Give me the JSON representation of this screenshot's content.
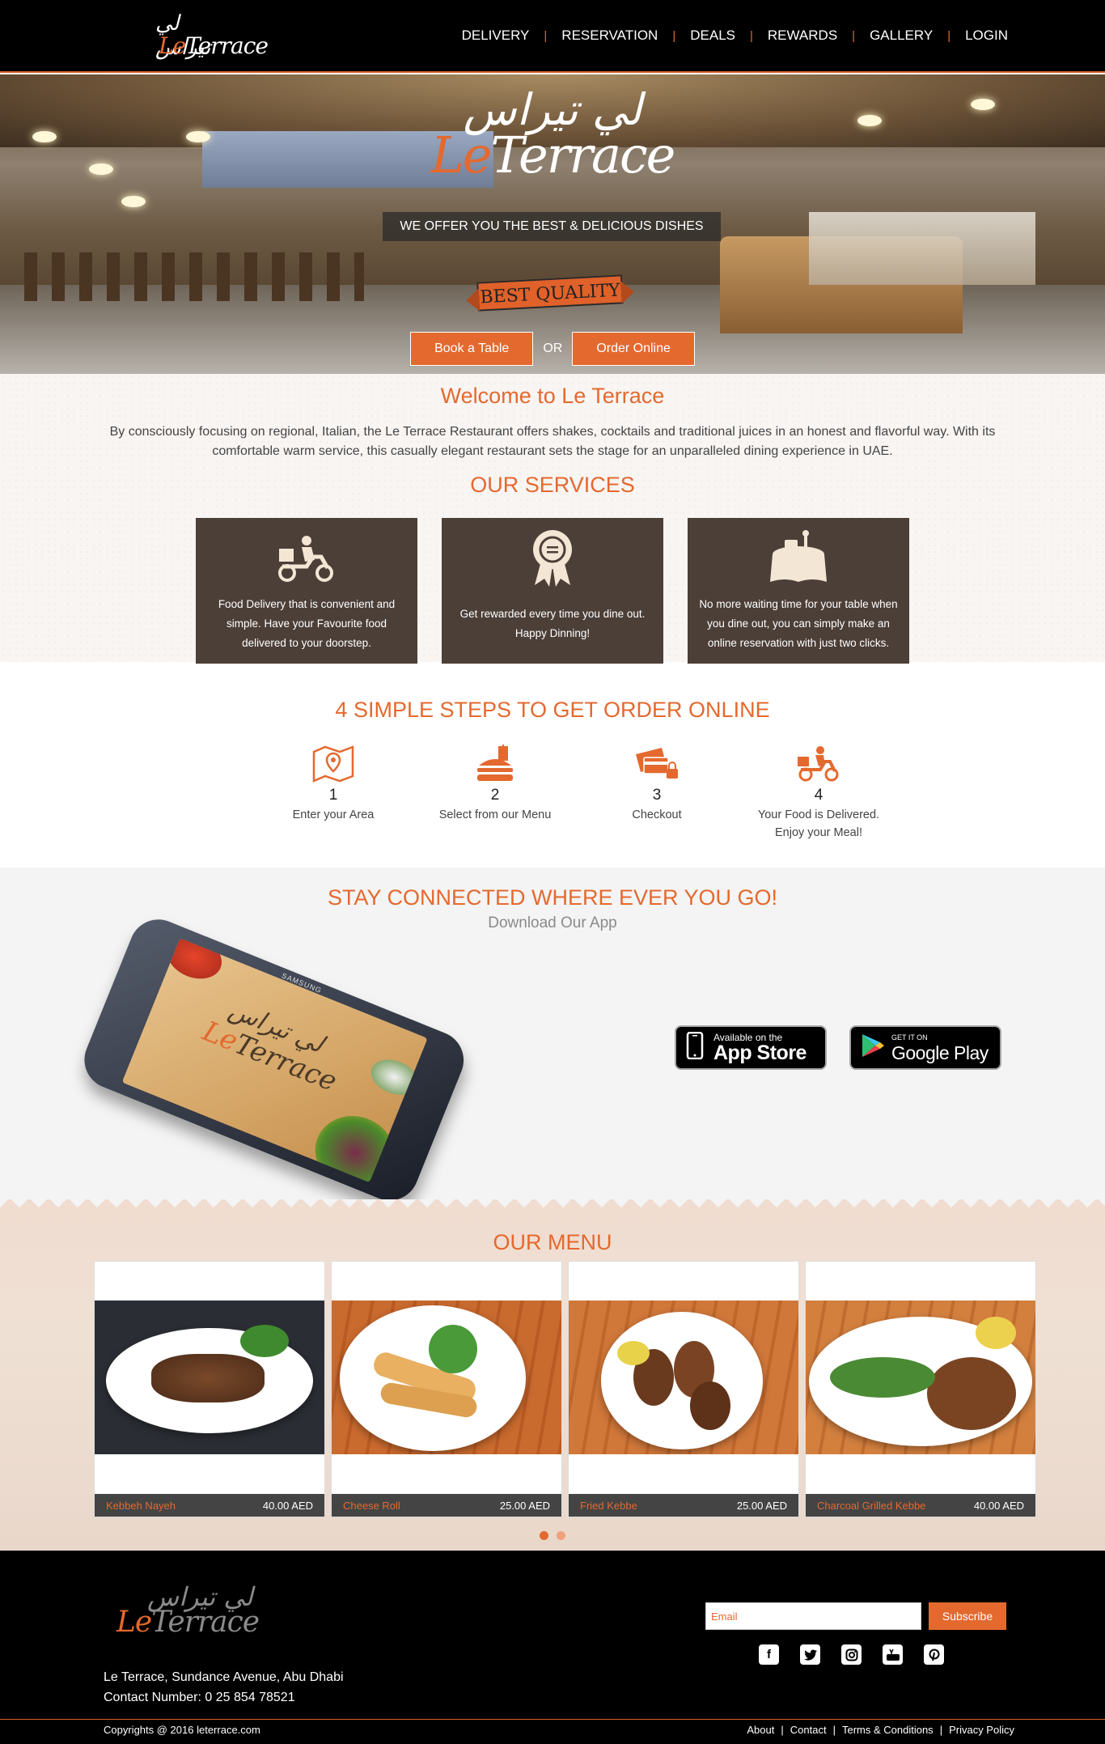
{
  "header": {
    "logo_ar": "لي تيراس",
    "logo_en_le": "Le",
    "logo_en_rest": "Terrace",
    "nav": [
      "DELIVERY",
      "RESERVATION",
      "DEALS",
      "REWARDS",
      "GALLERY",
      "LOGIN"
    ],
    "separator": "|"
  },
  "hero": {
    "logo_ar": "لي تيراس",
    "logo_en_le": "Le",
    "logo_en_rest": "Terrace",
    "tagline": "WE OFFER YOU THE BEST & DELICIOUS DISHES",
    "ribbon": "BEST QUALITY",
    "book_label": "Book a Table",
    "or_label": "OR",
    "order_label": "Order Online"
  },
  "welcome": {
    "title": "Welcome to Le Terrace",
    "text": "By consciously focusing on regional, Italian, the Le Terrace Restaurant offers shakes, cocktails and traditional juices in an honest and flavorful way. With its comfortable warm service, this casually elegant restaurant sets the stage for an unparalleled dining experience in UAE."
  },
  "services": {
    "title": "OUR SERVICES",
    "items": [
      {
        "icon": "scooter-delivery-icon",
        "text": "Food Delivery that is convenient and simple. Have your Favourite food delivered to your doorstep."
      },
      {
        "icon": "award-ribbon-icon",
        "text": "Get rewarded every time you dine out. Happy Dinning!"
      },
      {
        "icon": "reserved-table-icon",
        "text": "No more waiting time for your table when you dine out, you can simply make an online reservation with just two clicks."
      }
    ]
  },
  "steps": {
    "title": "4 SIMPLE STEPS TO GET ORDER ONLINE",
    "items": [
      {
        "icon": "map-pin-icon",
        "num": "1",
        "label": "Enter your Area",
        "label2": ""
      },
      {
        "icon": "burger-drink-icon",
        "num": "2",
        "label": "Select from our Menu",
        "label2": ""
      },
      {
        "icon": "card-lock-icon",
        "num": "3",
        "label": "Checkout",
        "label2": ""
      },
      {
        "icon": "delivery-scooter-icon",
        "num": "4",
        "label": "Your Food is Delivered.",
        "label2": "Enjoy your Meal!"
      }
    ]
  },
  "app": {
    "title": "STAY CONNECTED WHERE EVER YOU GO!",
    "subtitle": "Download Our App",
    "phone_brand": "SAMSUNG",
    "appstore_small": "Available on the",
    "appstore_big": "App Store",
    "gplay_small": "GET IT ON",
    "gplay_big": "Google Play"
  },
  "menu": {
    "title": "OUR MENU",
    "items": [
      {
        "name": "Kebbeh Nayeh",
        "price": "40.00 AED"
      },
      {
        "name": "Cheese Roll",
        "price": "25.00 AED"
      },
      {
        "name": "Fried Kebbe",
        "price": "25.00 AED"
      },
      {
        "name": "Charcoal Grilled Kebbe",
        "price": "40.00 AED"
      }
    ],
    "active_page": 1,
    "pages": 2
  },
  "footer": {
    "logo_ar": "لي تيراس",
    "logo_en_le": "Le",
    "logo_en_rest": "Terrace",
    "address": "Le Terrace, Sundance Avenue, Abu Dhabi",
    "contact": "Contact Number: 0 25 854 78521",
    "email_placeholder": "Email",
    "subscribe_label": "Subscribe",
    "social": [
      "facebook-icon",
      "twitter-icon",
      "instagram-icon",
      "youtube-icon",
      "pinterest-icon"
    ],
    "copyright": "Copyrights @ 2016 leterrace.com",
    "links": [
      "About",
      "Contact",
      "Terms & Conditions",
      "Privacy Policy"
    ]
  },
  "colors": {
    "accent": "#e4692f",
    "service_bg": "#4c3f38",
    "header_bg": "#000000"
  }
}
